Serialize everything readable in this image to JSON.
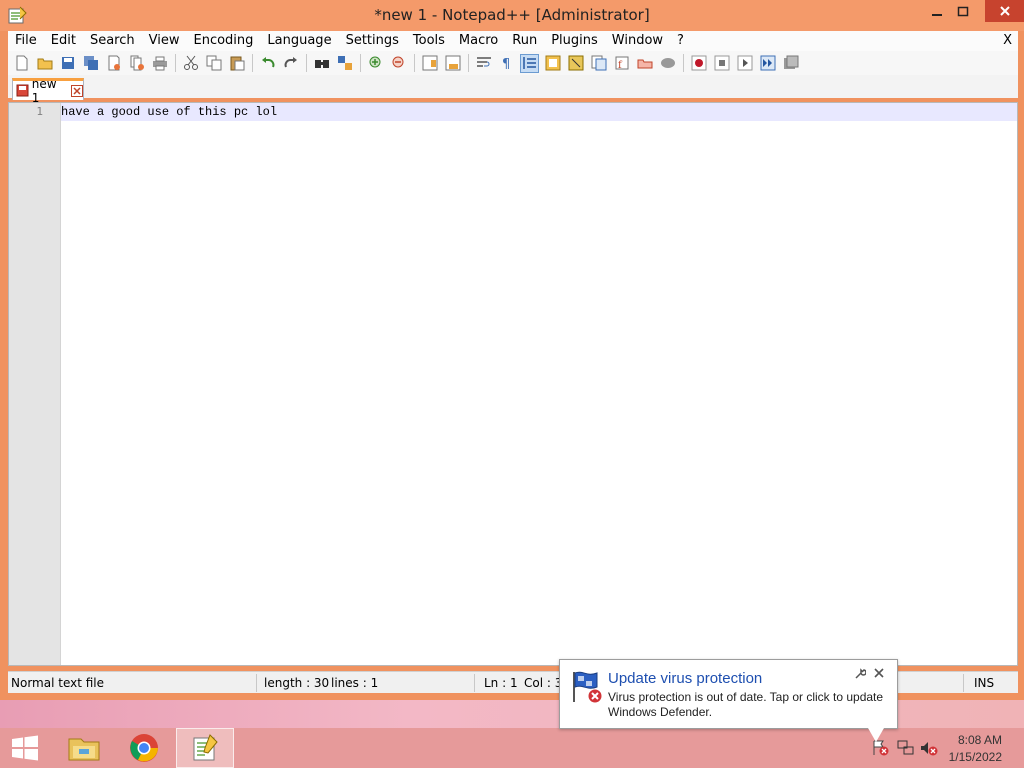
{
  "window": {
    "title": "*new 1 - Notepad++ [Administrator]",
    "menu_close": "X"
  },
  "menu": [
    "File",
    "Edit",
    "Search",
    "View",
    "Encoding",
    "Language",
    "Settings",
    "Tools",
    "Macro",
    "Run",
    "Plugins",
    "Window",
    "?"
  ],
  "toolbar_icons": [
    "new-file-icon",
    "open-file-icon",
    "save-icon",
    "save-all-icon",
    "close-icon",
    "close-all-icon",
    "print-icon",
    "cut-icon",
    "copy-icon",
    "paste-icon",
    "undo-icon",
    "redo-icon",
    "find-icon",
    "replace-icon",
    "zoom-in-icon",
    "zoom-out-icon",
    "sync-vertical-icon",
    "sync-horizontal-icon",
    "word-wrap-icon",
    "show-all-chars-icon",
    "indent-guide-icon",
    "udl-icon",
    "doc-map-icon",
    "function-list-icon",
    "folder-workspace-icon",
    "doc-switcher-icon",
    "monitoring-icon",
    "record-macro-icon",
    "stop-record-icon",
    "play-macro-icon",
    "run-macro-multiple-icon",
    "save-macro-icon"
  ],
  "tab": {
    "label": "new 1"
  },
  "editor": {
    "line_number": "1",
    "text": "have a good use of this pc lol"
  },
  "status": {
    "file_type": "Normal text file",
    "length": "length : 30",
    "lines": "lines : 1",
    "ln": "Ln : 1",
    "col": "Col : 31",
    "mode": "INS"
  },
  "notification": {
    "title": "Update virus protection",
    "body": "Virus protection is out of date. Tap or click to update Windows Defender."
  },
  "taskbar": {
    "time": "8:08 AM",
    "date": "1/15/2022"
  },
  "colors": {
    "frame": "#f0925f",
    "accent_blue": "#1e4fb0",
    "record_red": "#c0182a"
  }
}
